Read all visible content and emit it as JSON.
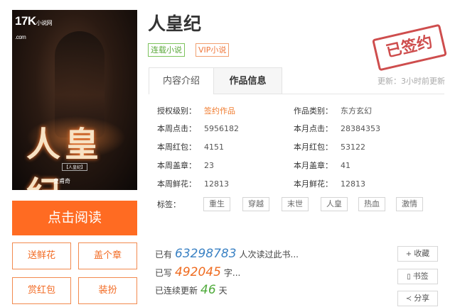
{
  "cover": {
    "logo": "17K",
    "logo_sub": "小说网",
    "logo_domain": ".com",
    "title_art": "人皇纪",
    "tag": "【人皇纪】",
    "author": "皇甫奇"
  },
  "book": {
    "title": "人皇纪",
    "badges": {
      "serial": "连载小说",
      "vip": "VIP小说"
    },
    "stamp": "已签约"
  },
  "tabs": {
    "intro": "内容介绍",
    "info": "作品信息"
  },
  "update_text": "更新：3小时前更新",
  "info": {
    "auth_level_label": "授权级别：",
    "auth_level": "签约作品",
    "category_label": "作品类别：",
    "category": "东方玄幻",
    "week_clicks_label": "本周点击：",
    "week_clicks": "5956182",
    "month_clicks_label": "本月点击：",
    "month_clicks": "28384353",
    "week_red_label": "本周红包：",
    "week_red": "4151",
    "month_red_label": "本月红包：",
    "month_red": "53122",
    "week_stamp_label": "本周盖章：",
    "week_stamp": "23",
    "month_stamp_label": "本月盖章：",
    "month_stamp": "41",
    "week_flower_label": "本周鲜花：",
    "week_flower": "12813",
    "month_flower_label": "本月鲜花：",
    "month_flower": "12813"
  },
  "tags": {
    "label": "标签：",
    "items": [
      "重生",
      "穿越",
      "末世",
      "人皇",
      "热血",
      "激情"
    ]
  },
  "stats": {
    "read_prefix": "已有",
    "read_count": "63298783",
    "read_suffix": "人次读过此书...",
    "written_prefix": "已写",
    "written_count": "492045",
    "written_suffix": "字...",
    "streak_prefix": "已连续更新",
    "streak_days": "46",
    "streak_suffix": "天"
  },
  "buttons": {
    "read": "点击阅读",
    "flower": "送鲜花",
    "stamp": "盖个章",
    "redpacket": "赏红包",
    "dress": "装扮",
    "collect": "收藏",
    "bookmark": "书签",
    "share": "分享"
  },
  "colors": {
    "accent": "#ff6b22",
    "serial_green": "#5aa83a",
    "stamp_red": "#c62f2f",
    "count_blue": "#3b82c4"
  }
}
